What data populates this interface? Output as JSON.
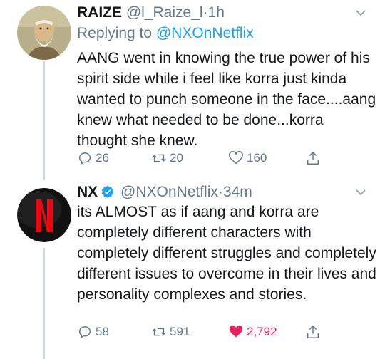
{
  "tweets": [
    {
      "name": "RAIZE",
      "handle": "@l_Raize_l",
      "time": "1h",
      "replying_label": "Replying to",
      "replying_to": "@NXOnNetflix",
      "text": "AANG went in knowing the true power of his spirit side while i feel like korra just kinda wanted to punch someone in the face....aang knew what needed to be done...korra thought she knew.",
      "replies": "26",
      "retweets": "20",
      "likes": "160",
      "liked": false
    },
    {
      "name": "NX",
      "verified": true,
      "handle": "@NXOnNetflix",
      "time": "34m",
      "text": "its ALMOST as if aang and korra are completely different characters with completely different struggles and completely different issues to overcome in their lives and personality complexes and stories.",
      "replies": "58",
      "retweets": "591",
      "likes": "2,792",
      "liked": true
    }
  ],
  "colors": {
    "link": "#1da1f2",
    "muted": "#657786",
    "liked": "#e0245e",
    "verified": "#1da1f2",
    "brand": "#e50914"
  },
  "icons": [
    "reply-icon",
    "retweet-icon",
    "like-icon",
    "share-icon",
    "chevron-down-icon",
    "verified-badge-icon"
  ]
}
